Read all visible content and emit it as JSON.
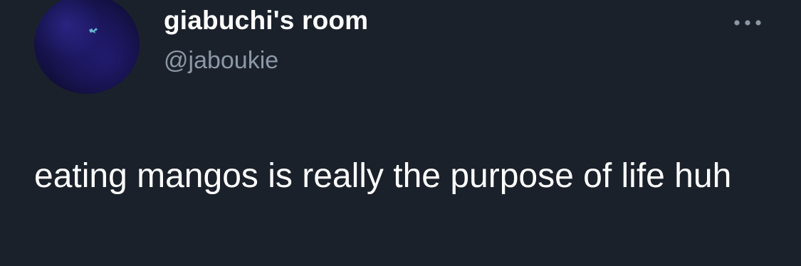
{
  "tweet": {
    "author": {
      "display_name": "giabuchi's room",
      "handle": "@jaboukie",
      "avatar_icon": "avatar-image"
    },
    "more_icon": "more-options-icon",
    "text": "eating mangos is really the purpose of life huh"
  },
  "colors": {
    "background": "#1b212b",
    "text_primary": "#ffffff",
    "text_secondary": "#8b98a5"
  }
}
